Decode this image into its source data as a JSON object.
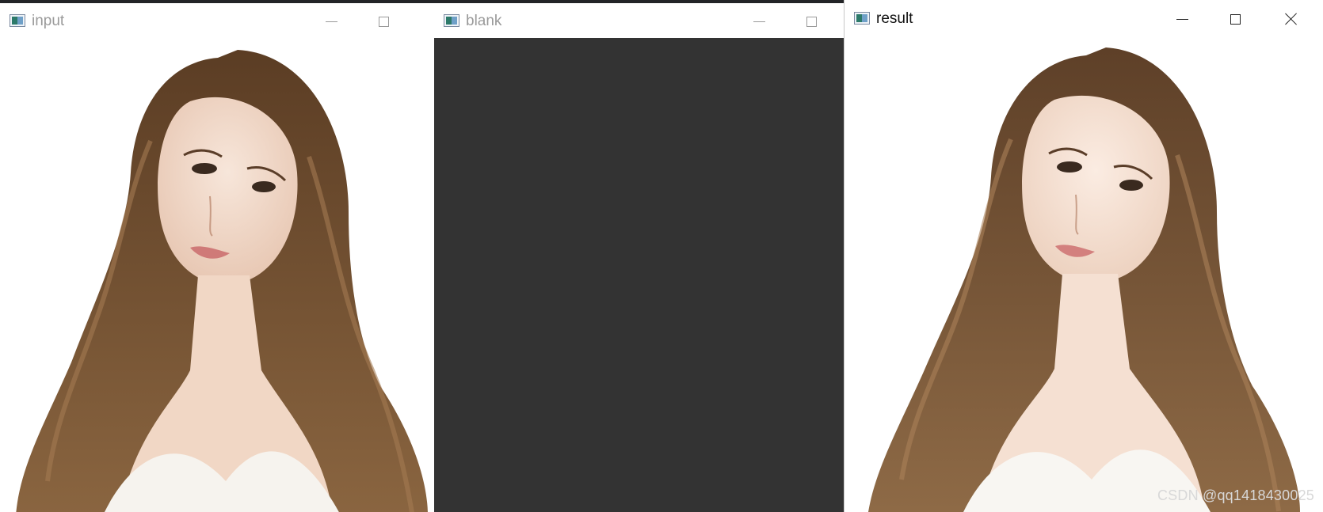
{
  "windows": {
    "input": {
      "title": "input"
    },
    "blank": {
      "title": "blank"
    },
    "result": {
      "title": "result"
    }
  },
  "watermark": "CSDN @qq1418430025",
  "colors": {
    "blank_fill": "#333333",
    "window_bg": "#ffffff",
    "hair": "#6b4a2b",
    "skin": "#f3dccc",
    "dress": "#f4f0ea"
  },
  "icons": {
    "app": "opencv-window-icon",
    "minimize": "minimize-icon",
    "maximize": "maximize-icon",
    "close": "close-icon"
  }
}
